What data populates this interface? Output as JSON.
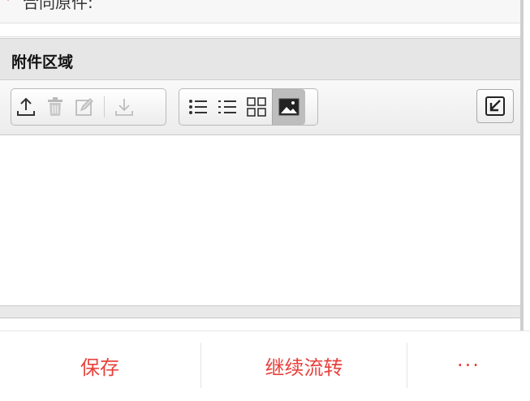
{
  "form": {
    "required_mark": "*",
    "partial_field_label": "合同原件:"
  },
  "attachment": {
    "header_title": "附件区域"
  },
  "actions": {
    "save_label": "保存",
    "continue_label": "继续流转",
    "more_label": "···"
  },
  "colors": {
    "accent": "#e8413c"
  }
}
